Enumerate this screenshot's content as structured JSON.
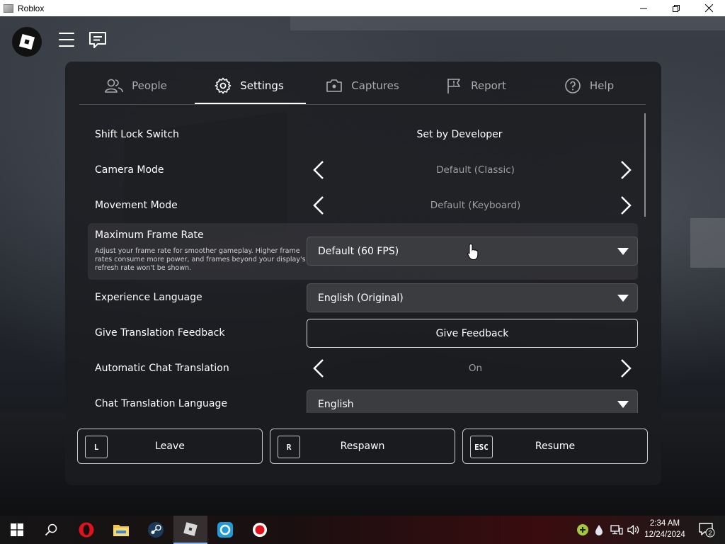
{
  "window": {
    "title": "Roblox"
  },
  "tabs": [
    {
      "label": "People",
      "icon": "people-icon"
    },
    {
      "label": "Settings",
      "icon": "gear-icon"
    },
    {
      "label": "Captures",
      "icon": "camera-icon"
    },
    {
      "label": "Report",
      "icon": "flag-icon"
    },
    {
      "label": "Help",
      "icon": "help-icon"
    }
  ],
  "settings": {
    "shift_lock": {
      "label": "Shift Lock Switch",
      "value": "Set by Developer"
    },
    "camera_mode": {
      "label": "Camera Mode",
      "value": "Default (Classic)"
    },
    "movement_mode": {
      "label": "Movement Mode",
      "value": "Default (Keyboard)"
    },
    "frame_rate": {
      "label": "Maximum Frame Rate",
      "description": "Adjust your frame rate for smoother gameplay. Higher frame rates consume more power, and frames beyond your display's refresh rate won't be shown.",
      "value": "Default (60 FPS)"
    },
    "experience_language": {
      "label": "Experience Language",
      "value": "English (Original)"
    },
    "translation_feedback": {
      "label": "Give Translation Feedback",
      "button": "Give Feedback"
    },
    "auto_chat_translation": {
      "label": "Automatic Chat Translation",
      "value": "On"
    },
    "chat_translation_language": {
      "label": "Chat Translation Language",
      "value": "English"
    }
  },
  "actions": {
    "leave": {
      "key": "L",
      "label": "Leave"
    },
    "respawn": {
      "key": "R",
      "label": "Respawn"
    },
    "resume": {
      "key": "ESC",
      "label": "Resume"
    }
  },
  "taskbar": {
    "time": "2:34 AM",
    "date": "12/24/2024",
    "notification_count": "2"
  }
}
